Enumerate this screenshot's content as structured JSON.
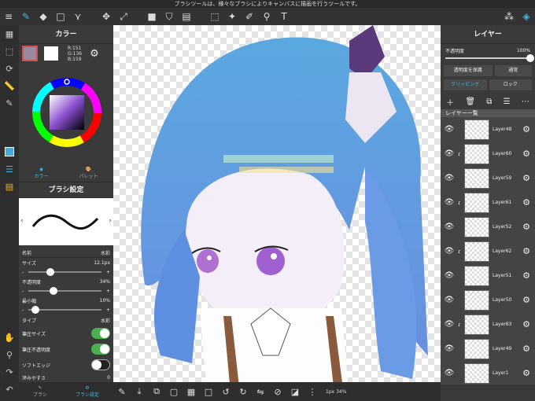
{
  "status": {
    "text": "ブラシツールは、様々なブラシによりキャンバスに描画を行うツールです。"
  },
  "color_panel": {
    "title": "カラー",
    "rgb": {
      "r": "R:151",
      "g": "G:136",
      "b": "B:159"
    },
    "tabs": [
      {
        "label": "カラー"
      },
      {
        "label": "パレット"
      }
    ]
  },
  "brush_panel": {
    "title": "ブラシ設定",
    "name_label": "名前",
    "name_value": "水彩",
    "size_label": "サイズ",
    "size_value": "12.1px",
    "size_level": 0.3,
    "opacity_label": "不透明度",
    "opacity_value": "34%",
    "opacity_level": 0.34,
    "min_width_label": "最小幅",
    "min_width_value": "10%",
    "min_width_level": 0.1,
    "type_label": "タイプ",
    "type_value": "水彩",
    "pressure_size_label": "筆圧サイズ",
    "pressure_opacity_label": "筆圧不透明度",
    "soft_edge_label": "ソフトエッジ",
    "blur_label": "滲みやすさ",
    "blur_value": "0"
  },
  "bottom_tabs": [
    {
      "label": "ブラシ"
    },
    {
      "label": "ブラシ設定"
    }
  ],
  "zoom": {
    "text": "1px 34%"
  },
  "layer_panel": {
    "title": "レイヤー",
    "opacity_label": "不透明度",
    "opacity_value": "100%",
    "protect_label": "透明度を保護",
    "blend_label": "通常",
    "clipping_label": "クリッピング",
    "lock_label": "ロック",
    "list_title": "レイヤー一覧",
    "layers": [
      {
        "name": "Layer48",
        "clip": false
      },
      {
        "name": "Layer60",
        "clip": true
      },
      {
        "name": "Layer59",
        "clip": false
      },
      {
        "name": "Layer61",
        "clip": true
      },
      {
        "name": "Layer52",
        "clip": false
      },
      {
        "name": "Layer62",
        "clip": true
      },
      {
        "name": "Layer51",
        "clip": false
      },
      {
        "name": "Layer50",
        "clip": false
      },
      {
        "name": "Layer63",
        "clip": true
      },
      {
        "name": "Layer49",
        "clip": false
      },
      {
        "name": "Layer1",
        "clip": false
      }
    ]
  },
  "colors": {
    "accent": "#3fb6e8",
    "toggle_on": "#4caf50"
  }
}
